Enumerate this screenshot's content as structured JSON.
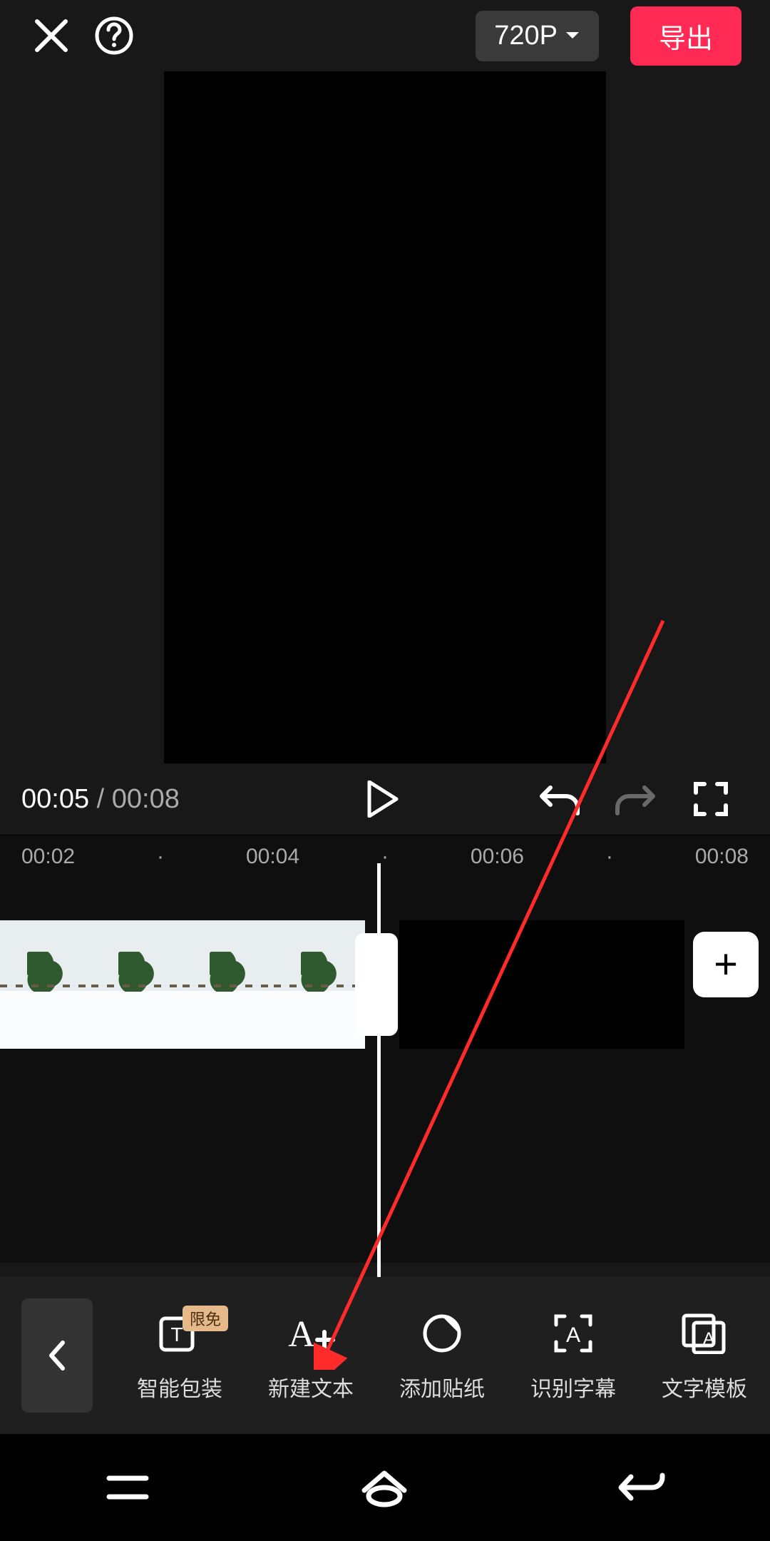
{
  "header": {
    "resolution": "720P",
    "export": "导出"
  },
  "playback": {
    "current": "00:05",
    "total": "00:08",
    "separator": " / "
  },
  "ruler": [
    "00:02",
    "·",
    "00:04",
    "·",
    "00:06",
    "·",
    "00:08"
  ],
  "bottom": {
    "tools": [
      {
        "label": "智能包装",
        "badge": "限免",
        "icon": "text-box-sparkle-icon"
      },
      {
        "label": "新建文本",
        "badge": "",
        "icon": "a-plus-icon"
      },
      {
        "label": "添加贴纸",
        "badge": "",
        "icon": "sticker-icon"
      },
      {
        "label": "识别字幕",
        "badge": "",
        "icon": "scan-a-icon"
      },
      {
        "label": "文字模板",
        "badge": "",
        "icon": "template-a-icon"
      }
    ]
  },
  "add_button": "+",
  "colors": {
    "accent": "#ff2b54"
  }
}
